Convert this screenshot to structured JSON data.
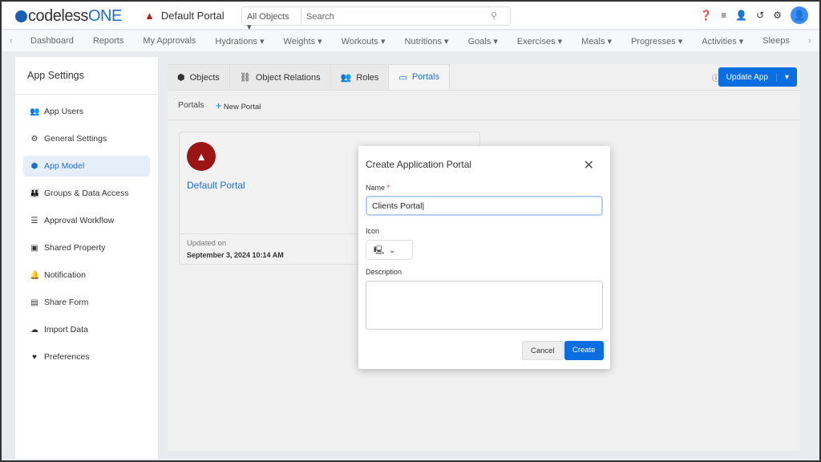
{
  "header": {
    "logo": "codelessONE",
    "portal_name": "Default Portal",
    "search_scope": "All Objects",
    "search_placeholder": "Search"
  },
  "nav": {
    "items": [
      "Dashboard",
      "Reports",
      "My Approvals",
      "Hydrations ▾",
      "Weights ▾",
      "Workouts ▾",
      "Nutritions ▾",
      "Goals ▾",
      "Exercises ▾",
      "Meals ▾",
      "Progresses ▾",
      "Activities ▾",
      "Sleeps"
    ]
  },
  "sidebar": {
    "title": "App Settings",
    "items": [
      {
        "label": "App Users",
        "icon": "👥"
      },
      {
        "label": "General Settings",
        "icon": "⚙"
      },
      {
        "label": "App Model",
        "icon": "⬢"
      },
      {
        "label": "Groups & Data Access",
        "icon": "👪"
      },
      {
        "label": "Approval Workflow",
        "icon": "☰"
      },
      {
        "label": "Shared Property",
        "icon": "▣"
      },
      {
        "label": "Notification",
        "icon": "🔔"
      },
      {
        "label": "Share Form",
        "icon": "▤"
      },
      {
        "label": "Import Data",
        "icon": "☁"
      },
      {
        "label": "Preferences",
        "icon": "♥"
      }
    ]
  },
  "tabs": [
    {
      "label": "Objects",
      "icon": "⬢"
    },
    {
      "label": "Object Relations",
      "icon": "⛓"
    },
    {
      "label": "Roles",
      "icon": "👥"
    },
    {
      "label": "Portals",
      "icon": "▭"
    }
  ],
  "toolbar": {
    "update_label": "Update App",
    "sub_title": "Portals",
    "new_portal": "New Portal"
  },
  "card": {
    "name": "Default Portal",
    "updated_label": "Updated on",
    "updated_value": "September 3, 2024 10:14 AM"
  },
  "modal": {
    "title": "Create Application Portal",
    "name_label": "Name",
    "required": "*",
    "name_value": "Clients Portal",
    "icon_label": "Icon",
    "description_label": "Description",
    "cancel": "Cancel",
    "create": "Create"
  }
}
